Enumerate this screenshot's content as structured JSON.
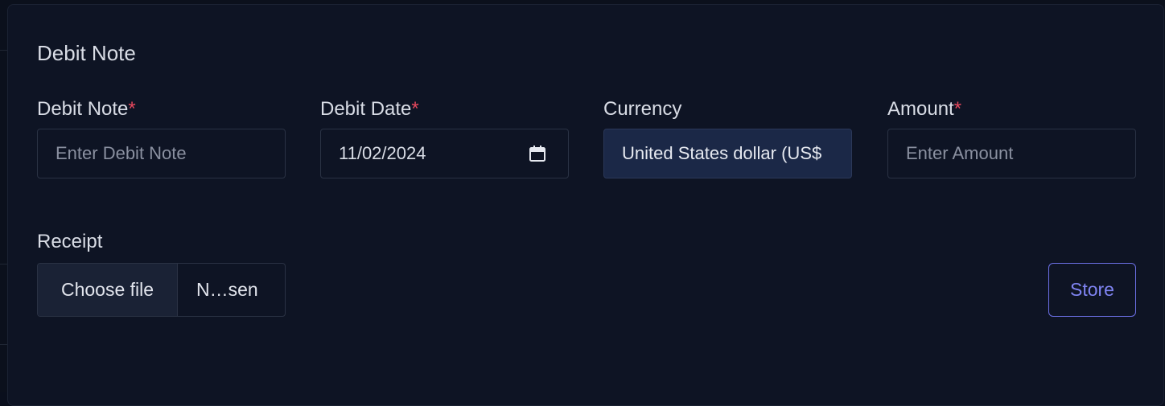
{
  "modal": {
    "title": "Debit Note"
  },
  "fields": {
    "debit_note": {
      "label": "Debit Note",
      "required_mark": "*",
      "placeholder": "Enter Debit Note"
    },
    "debit_date": {
      "label": "Debit Date",
      "required_mark": "*",
      "value": "11/02/2024",
      "icon": "calendar-icon"
    },
    "currency": {
      "label": "Currency",
      "value": "United States dollar (US$"
    },
    "amount": {
      "label": "Amount",
      "required_mark": "*",
      "placeholder": "Enter Amount"
    },
    "receipt": {
      "label": "Receipt",
      "button_label": "Choose file",
      "file_status": "N…sen"
    }
  },
  "actions": {
    "store_label": "Store"
  },
  "colors": {
    "modal_bg": "#0e1424",
    "required": "#e5485d",
    "accent": "#6c70e6",
    "select_bg": "#1b2847"
  }
}
